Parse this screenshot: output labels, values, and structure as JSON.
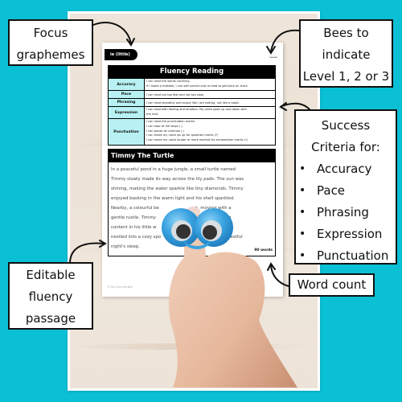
{
  "colors": {
    "background": "#0bbfd4",
    "label_cell": "#b8f1f3",
    "header_black": "#000000",
    "googly_ring_blue": "#3aa3e0"
  },
  "worksheet": {
    "grapheme_tag": "ie (little)",
    "bees_icon": "bee-icons",
    "table_title": "Fluency Reading",
    "criteria": [
      {
        "label": "Accuracy",
        "lines": [
          "I can read the words correctly.",
          "If I make a mistake, I can self-correct and re-read to get back on track."
        ]
      },
      {
        "label": "Pace",
        "lines": [
          "I can read not too fast and not too slow."
        ]
      },
      {
        "label": "Phrasing",
        "lines": [
          "I can read smoothly and sound like I am talking, not like a robot."
        ]
      },
      {
        "label": "Expression",
        "lines": [
          "I can read with feeling and emotion. My voice goes up and down with",
          "the text."
        ]
      },
      {
        "label": "Punctuation",
        "lines": [
          "I can read the punctuation marks.",
          "I can stop at full stops (.)",
          "I can pause at commas (,)",
          "I can make my voice go up for question marks (?)",
          "I can make my voice louder or more excited for exclamation marks (!)"
        ]
      }
    ],
    "passage_title": "Timmy The Turtle",
    "passage_lines": [
      "In a peaceful pond in a huge jungle, a small turtle named",
      "Timmy slowly made its way across the lily pads. The sun was",
      "shining, making the water sparkle like tiny diamonds. Timmy",
      "enjoyed basking in the warm light and his shell sparkled.",
      "Nearby, a colourful be                          g, moving with a",
      "gentle rustle. Timmy                              xplored, feeling",
      "content in his little w                          o dusk, Timmy",
      "nestled into a cozy spo                        eaf, ready for a restful",
      "night's sleep."
    ],
    "word_count": "90 words",
    "copyright": "© Mrs Learning Bee"
  },
  "callouts": {
    "focus": [
      "Focus",
      "graphemes"
    ],
    "bees": [
      "Bees to",
      "indicate",
      "Level 1, 2 or 3"
    ],
    "success_heading": [
      "Success",
      "Criteria for:"
    ],
    "success_items": [
      "Accuracy",
      "Pace",
      "Phrasing",
      "Expression",
      "Punctuation"
    ],
    "word_count": "Word count",
    "editable": [
      "Editable",
      "fluency",
      "passage"
    ]
  }
}
